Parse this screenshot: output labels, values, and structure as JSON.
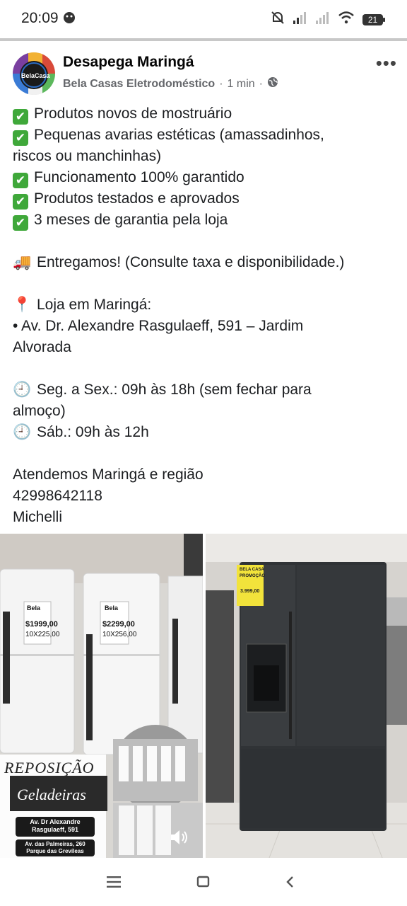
{
  "status_bar": {
    "time": "20:09",
    "battery": "21",
    "icons": [
      "notification-app-icon",
      "mute-icon",
      "signal-icon",
      "signal-icon-2",
      "wifi-icon",
      "battery-icon"
    ]
  },
  "post": {
    "group_name": "Desapega Maringá",
    "author": "Bela Casas Eletrodoméstico",
    "separator": "·",
    "time_ago": "1 min",
    "avatar_text": "BelaCasa",
    "more_label": "•••",
    "lines": [
      {
        "icon": "check-icon",
        "text": "Produtos novos de mostruário"
      },
      {
        "icon": "check-icon",
        "text": "Pequenas avarias estéticas (amassadinhos,"
      },
      {
        "icon": "",
        "text": "riscos ou manchinhas)"
      },
      {
        "icon": "check-icon",
        "text": "Funcionamento 100% garantido"
      },
      {
        "icon": "check-icon",
        "text": "Produtos testados e aprovados"
      },
      {
        "icon": "check-icon",
        "text": "3 meses de garantia pela loja"
      },
      {
        "icon": "",
        "text": ""
      },
      {
        "icon": "truck-icon",
        "text": "Entregamos! (Consulte taxa e disponibilidade.)"
      },
      {
        "icon": "",
        "text": ""
      },
      {
        "icon": "pin-icon",
        "text": "Loja em Maringá:"
      },
      {
        "icon": "",
        "text": "• Av. Dr. Alexandre Rasgulaeff, 591 – Jardim"
      },
      {
        "icon": "",
        "text": "Alvorada"
      },
      {
        "icon": "",
        "text": ""
      },
      {
        "icon": "clock-icon",
        "text": "Seg. a Sex.: 09h às 18h (sem fechar para"
      },
      {
        "icon": "",
        "text": "almoço)"
      },
      {
        "icon": "clock-icon",
        "text": "Sáb.: 09h às 12h"
      },
      {
        "icon": "",
        "text": ""
      },
      {
        "icon": "",
        "text": "Atendemos Maringá e região"
      },
      {
        "icon": "",
        "text": "42998642118"
      },
      {
        "icon": "",
        "text": "Michelli"
      }
    ]
  },
  "photo_left": {
    "price_1": "$1999,00",
    "installments_1": "10X225,00",
    "price_2": "$2299,00",
    "installments_2": "10X256,00",
    "banner_title": "REPOSIÇÃO",
    "banner_subtitle": "Geladeiras",
    "address_1": "Av. Dr Alexandre Rasgulaeff, 591",
    "address_2": "Av. das Palmeiras, 260 Parque das Grevíleas",
    "tag_brand": "Bela"
  },
  "photo_right": {
    "tag_text_1": "BELA CASA",
    "tag_text_2": "PROMOÇÃO",
    "tag_price": "3.999,00"
  },
  "nav": {
    "icons": [
      "menu-icon",
      "home-square-icon",
      "back-icon"
    ]
  }
}
